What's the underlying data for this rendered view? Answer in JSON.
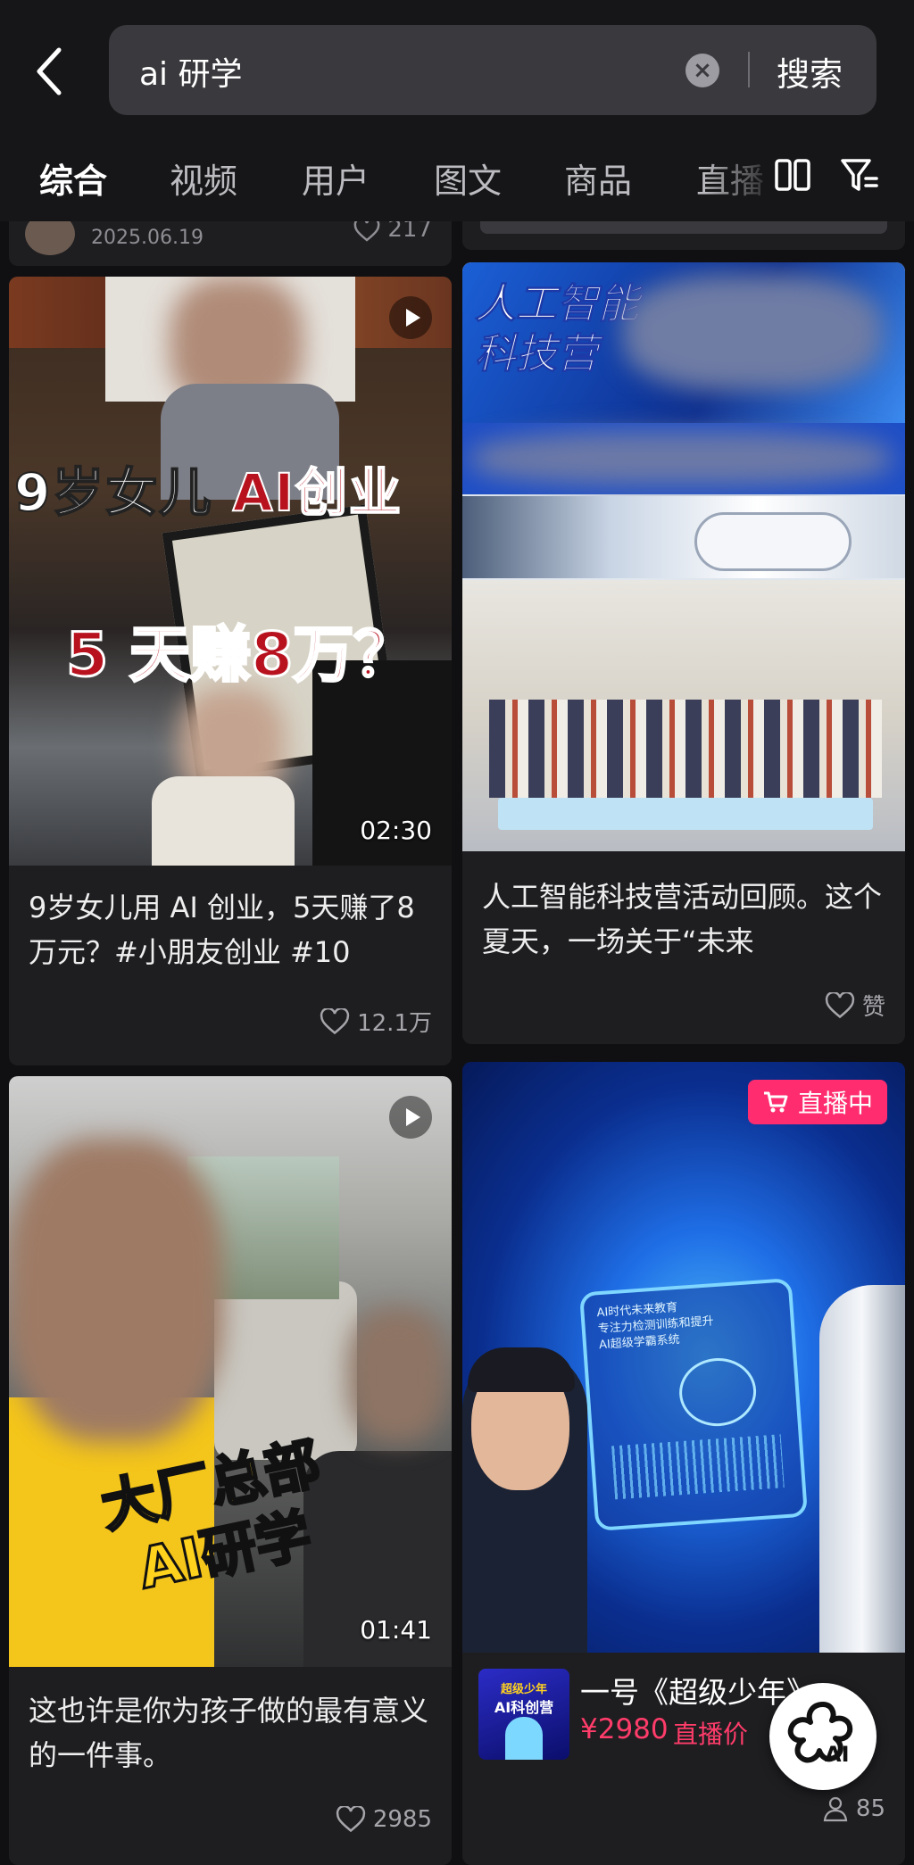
{
  "search": {
    "query": "ai 研学",
    "submit_label": "搜索"
  },
  "tabs": [
    "综合",
    "视频",
    "用户",
    "图文",
    "商品",
    "直播"
  ],
  "prev_card": {
    "date": "2025.06.19",
    "likes": "217"
  },
  "cards": [
    {
      "title": "9岁女儿用 AI 创业，5天赚了8万元？#小朋友创业 #10",
      "thumb_caption_line1": "9岁女儿",
      "thumb_caption_line1_accent": "AI创业",
      "thumb_caption_line2": "5 天赚8万？",
      "duration": "02:30",
      "likes": "12.1万"
    },
    {
      "title": "人工智能科技营活动回顾。这个夏天，一场关于“未来",
      "thumb_caption": "人工智能科技营",
      "thumb_caption_line1": "人工智能",
      "thumb_caption_line2": "科技营",
      "likes": "赞"
    },
    {
      "title": "这也许是你为孩子做的最有意义的一件事。",
      "thumb_caption_line1": "大厂总部",
      "thumb_caption_line2": "AI研学",
      "duration": "01:41",
      "likes": "2985"
    },
    {
      "live_label": "直播中",
      "product_thumb_line1": "超级少年",
      "product_thumb_line2": "AI科创营",
      "product_title": "一号《超级少年》",
      "price": "¥2980",
      "price_tag": "直播价",
      "viewers": "85",
      "screen_text_1": "AI时代未来教育",
      "screen_text_2": "专注力检测训练和提升",
      "screen_text_3": "AI超级学霸系统"
    }
  ],
  "fab_label": "AI",
  "colors": {
    "live_pink": "#ff2d6f",
    "price_red": "#ff3c6a",
    "caption_red": "#b8121f",
    "caption_yellow": "#ffd21e"
  }
}
